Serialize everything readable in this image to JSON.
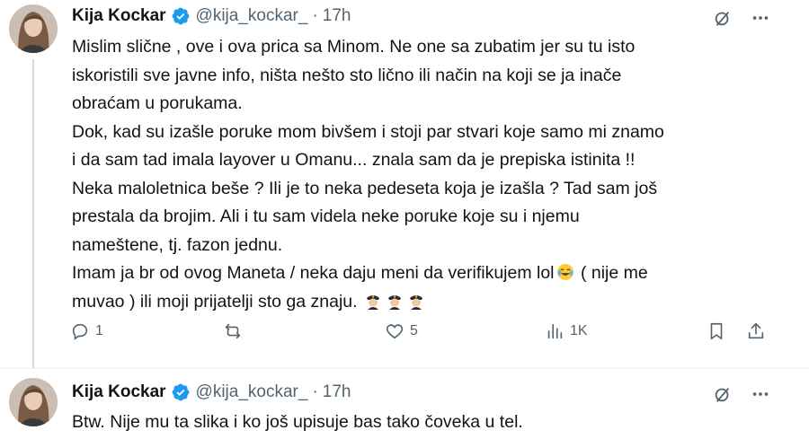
{
  "tweets": [
    {
      "author_name": "Kija Kockar",
      "handle": "@kija_kockar_",
      "separator": "·",
      "time": "17h",
      "lines": [
        "Mislim slične , ove i ova prica sa Minom. Ne one sa zubatim jer su tu isto",
        "iskoristili sve javne info, ništa nešto sto lično ili način na koji se ja inače",
        "obraćam u porukama.",
        "Dok, kad su izašle poruke mom bivšem i stoji par stvari koje samo mi znamo",
        "i da sam tad imala layover u Omanu... znala sam da je prepiska istinita !!",
        "Neka maloletnica beše ? Ili je to neka pedeseta koja je izašla ? Tad sam još",
        "prestala da brojim. Ali i tu sam videla neke poruke koje su i njemu",
        "nameštene, tj. fazon jednu."
      ],
      "line9_a": "Imam ja br od ovog Maneta / neka daju meni da verifikujem lol",
      "line9_b": " ( nije me",
      "line10": "muvao ) ili moji prijatelji sto ga znaju. ",
      "stats": {
        "replies": "1",
        "retweets": "",
        "likes": "5",
        "views": "1K"
      },
      "icons": {
        "verified": "verified-badge-icon",
        "grok": "grok-icon",
        "more": "more-icon",
        "laugh_emoji": "tears-of-joy-emoji",
        "police_emoji": "police-officer-emoji"
      }
    },
    {
      "author_name": "Kija Kockar",
      "handle": "@kija_kockar_",
      "separator": "·",
      "time": "17h",
      "text": "Btw. Nije mu ta slika i ko još upisuje bas tako čoveka u tel."
    }
  ],
  "colors": {
    "text": "#0f1419",
    "secondary": "#536471",
    "verified": "#1d9bf0",
    "thread_line": "#cfd9de"
  }
}
